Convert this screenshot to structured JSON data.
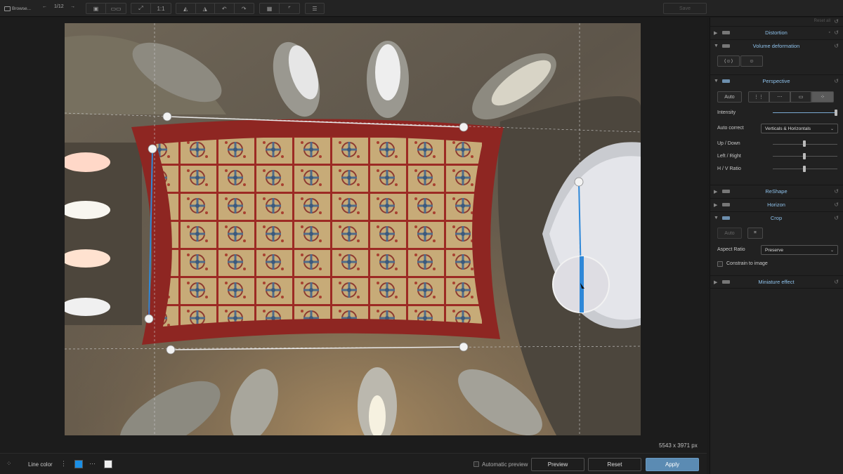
{
  "toolbar": {
    "browse_label": "Browse...",
    "page_counter": "1/12",
    "zoom_label": "1:1",
    "save_label": "Save"
  },
  "canvas": {
    "image_dimensions": "5543 x 3971 px"
  },
  "panel": {
    "reset_all_label": "Reset all",
    "sections": {
      "distortion": "Distortion",
      "volume_deformation": "Volume deformation",
      "perspective": "Perspective",
      "reshape": "ReShape",
      "horizon": "Horizon",
      "crop": "Crop",
      "miniature_effect": "Miniature effect"
    },
    "perspective": {
      "auto_label": "Auto",
      "intensity_label": "Intensity",
      "intensity_value": 1.0,
      "auto_correct_label": "Auto correct",
      "auto_correct_value": "Verticals & Horizontals",
      "up_down_label": "Up / Down",
      "up_down_value": 0,
      "left_right_label": "Left / Right",
      "left_right_value": 0,
      "hv_ratio_label": "H / V Ratio",
      "hv_ratio_value": 0
    },
    "crop": {
      "auto_label": "Auto",
      "aspect_ratio_label": "Aspect Ratio",
      "aspect_ratio_value": "Preserve",
      "constrain_label": "Constrain to image"
    }
  },
  "bottombar": {
    "line_color_label": "Line color",
    "line_color_swatches": [
      "#1a8fe6",
      "#f0f0f0"
    ],
    "automatic_preview_label": "Automatic preview",
    "preview_label": "Preview",
    "reset_label": "Reset",
    "apply_label": "Apply"
  },
  "colors": {
    "accent_blue": "#8ec1ea",
    "apply_button": "#5b8bb3",
    "guide_line_vertical": "#2f88d8"
  }
}
